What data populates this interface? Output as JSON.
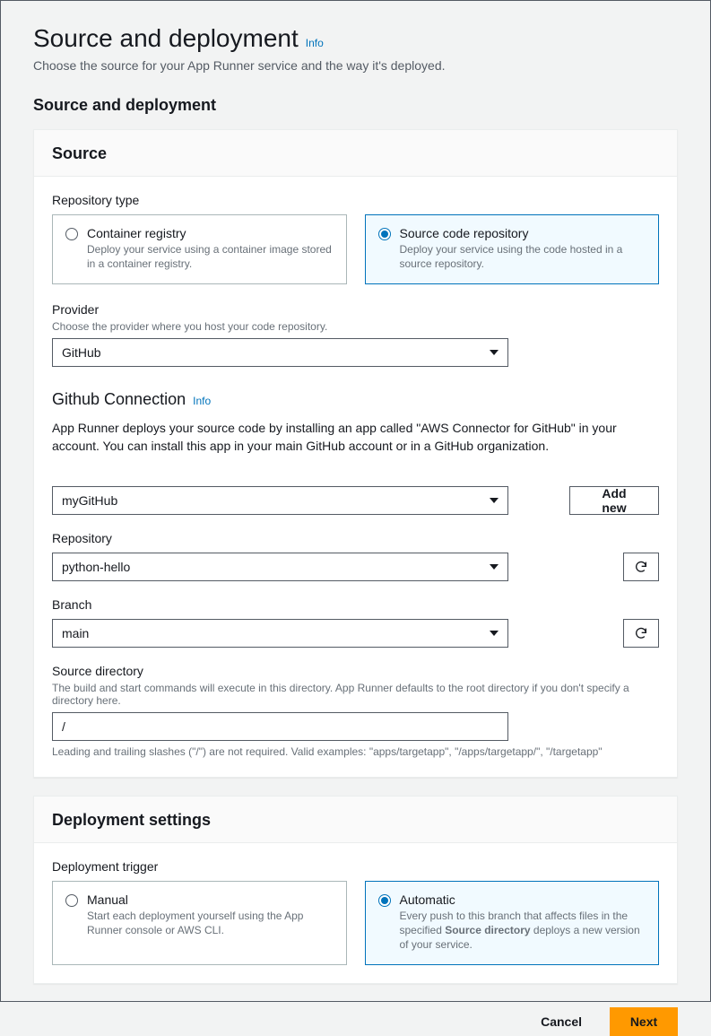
{
  "header": {
    "title": "Source and deployment",
    "info": "Info",
    "subtitle": "Choose the source for your App Runner service and the way it's deployed.",
    "section_label": "Source and deployment"
  },
  "source_panel": {
    "title": "Source",
    "repo_type": {
      "label": "Repository type",
      "container": {
        "title": "Container registry",
        "desc": "Deploy your service using a container image stored in a container registry."
      },
      "source_code": {
        "title": "Source code repository",
        "desc": "Deploy your service using the code hosted in a source repository."
      }
    },
    "provider": {
      "label": "Provider",
      "desc": "Choose the provider where you host your code repository.",
      "value": "GitHub"
    },
    "github_connection": {
      "title": "Github Connection",
      "info": "Info",
      "paragraph": "App Runner deploys your source code by installing an app called \"AWS Connector for GitHub\" in your account. You can install this app in your main GitHub account or in a GitHub organization.",
      "connection_value": "myGitHub",
      "add_new": "Add new",
      "repository": {
        "label": "Repository",
        "value": "python-hello"
      },
      "branch": {
        "label": "Branch",
        "value": "main"
      },
      "source_dir": {
        "label": "Source directory",
        "desc": "The build and start commands will execute in this directory. App Runner defaults to the root directory if you don't specify a directory here.",
        "value": "/",
        "hint": "Leading and trailing slashes (\"/\") are not required. Valid examples: \"apps/targetapp\", \"/apps/targetapp/\", \"/targetapp\""
      }
    }
  },
  "deployment_panel": {
    "title": "Deployment settings",
    "trigger_label": "Deployment trigger",
    "manual": {
      "title": "Manual",
      "desc": "Start each deployment yourself using the App Runner console or AWS CLI."
    },
    "automatic": {
      "title": "Automatic",
      "desc_pre": "Every push to this branch that affects files in the specified ",
      "desc_bold": "Source directory",
      "desc_post": " deploys a new version of your service."
    }
  },
  "footer": {
    "cancel": "Cancel",
    "next": "Next"
  }
}
